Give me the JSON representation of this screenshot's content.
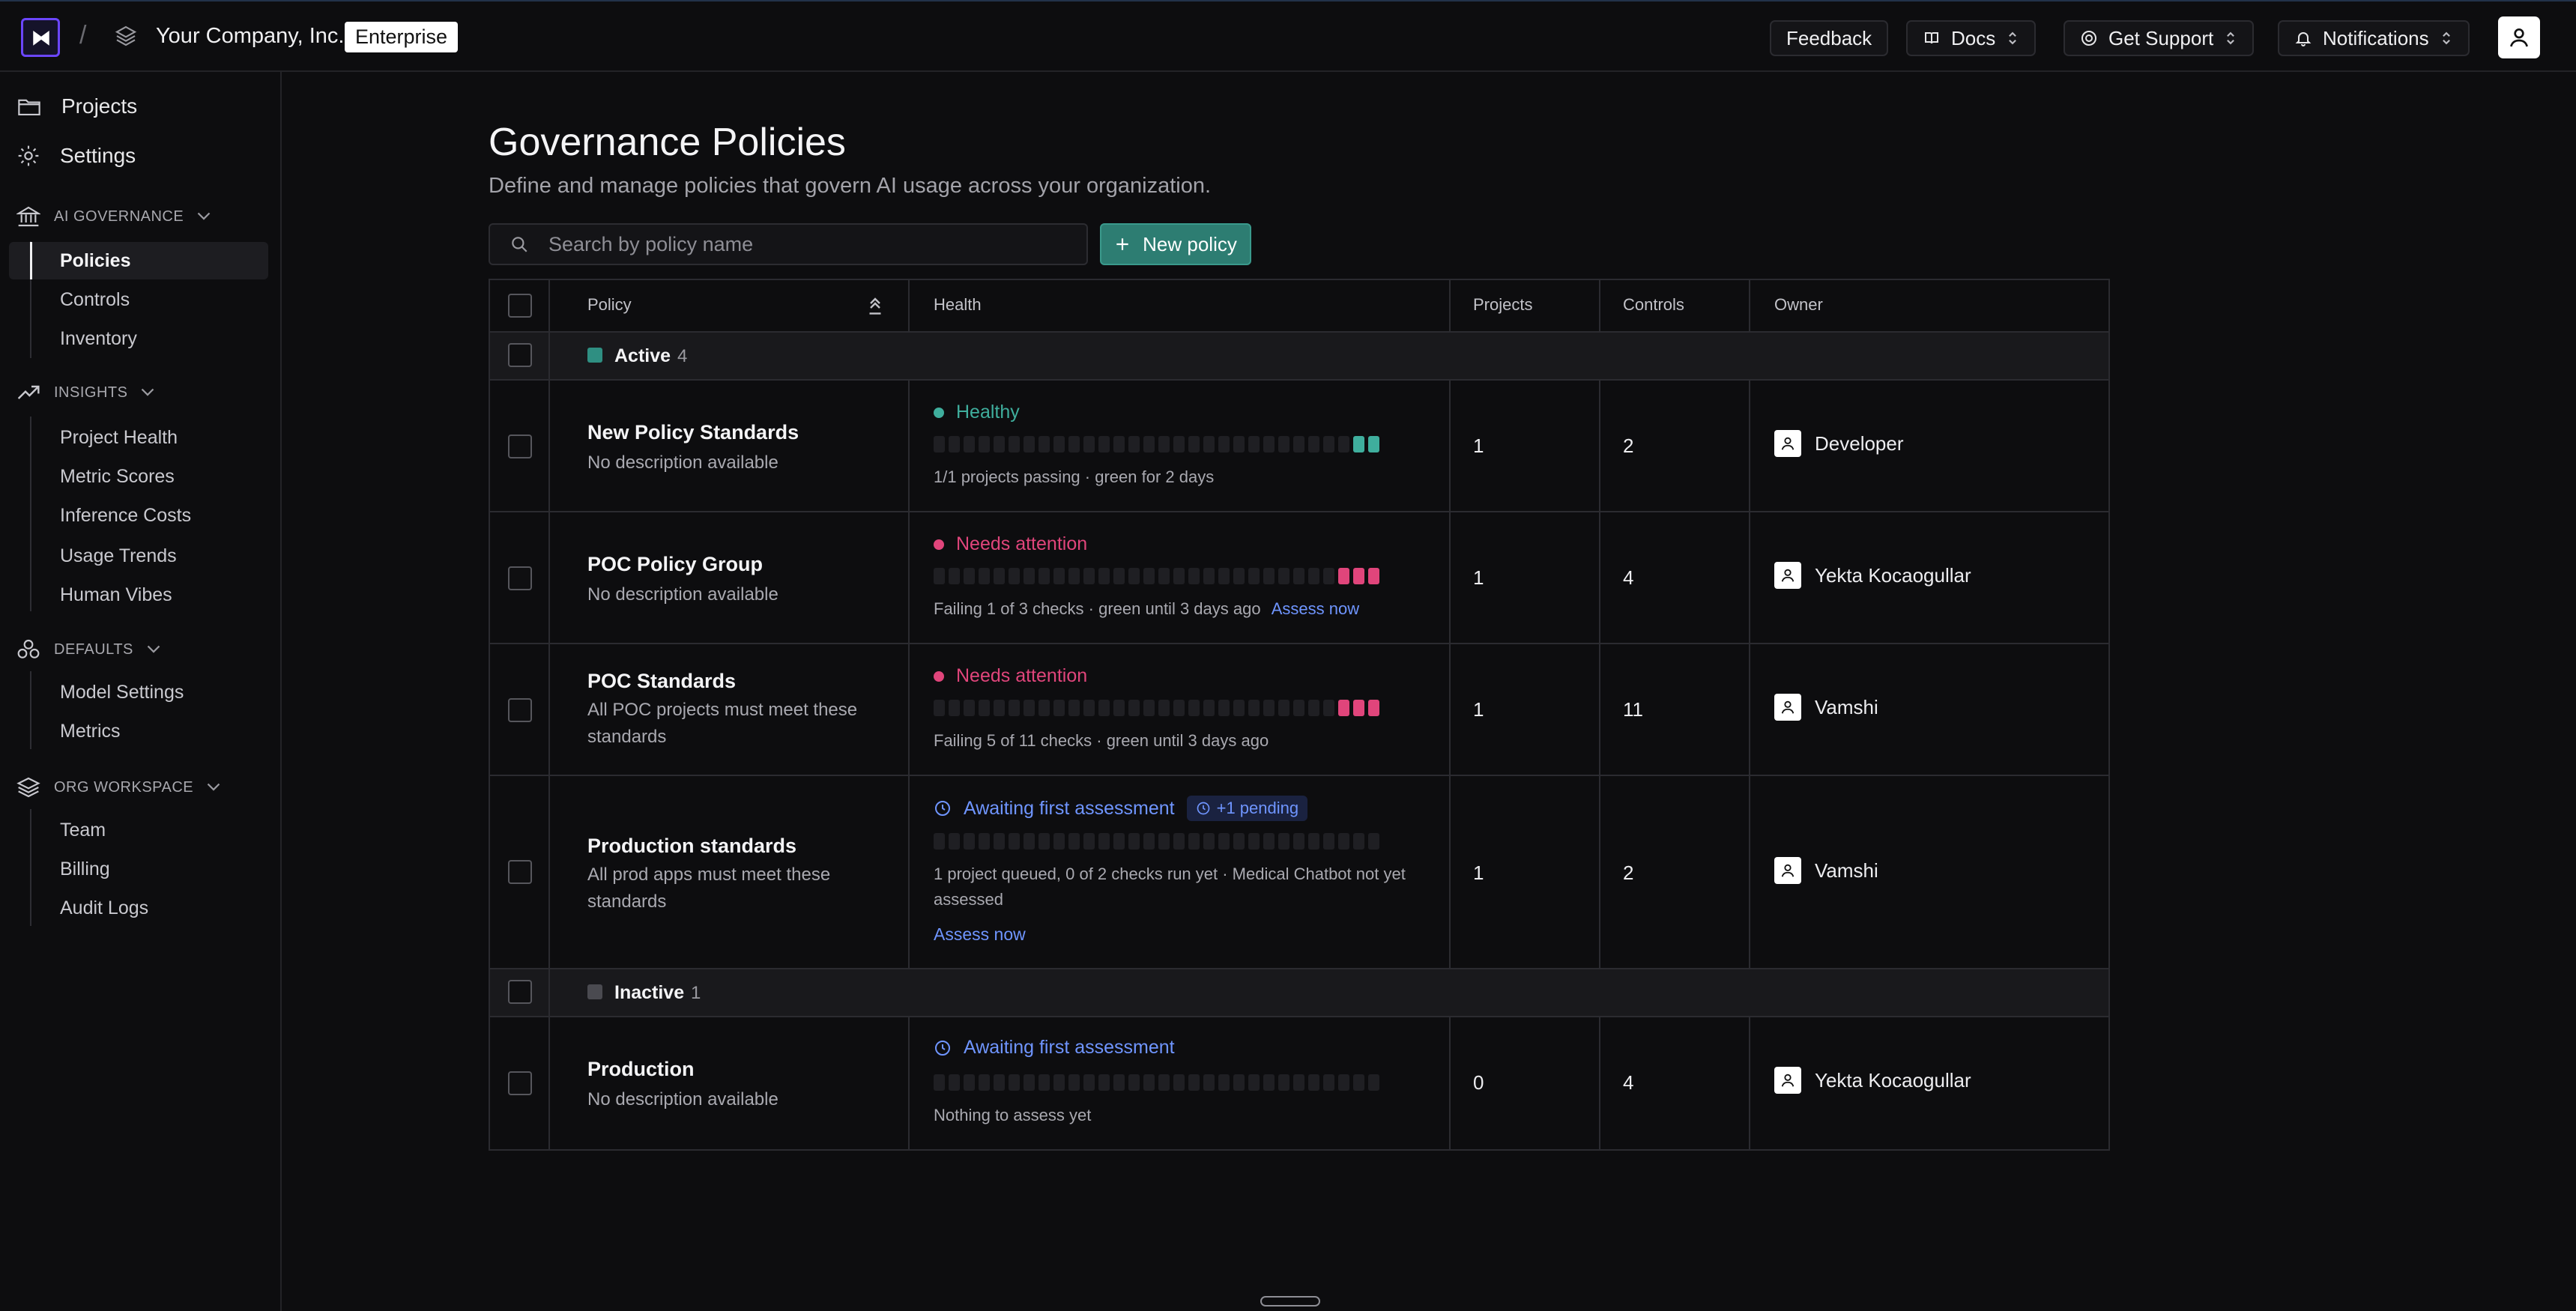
{
  "topbar": {
    "company": "Your Company, Inc.",
    "plan": "Enterprise",
    "feedback": "Feedback",
    "docs": "Docs",
    "support": "Get Support",
    "notifications": "Notifications"
  },
  "sidebar": {
    "projects": "Projects",
    "settings": "Settings",
    "ai_governance": {
      "title": "AI GOVERNANCE",
      "items": [
        "Policies",
        "Controls",
        "Inventory"
      ]
    },
    "insights": {
      "title": "INSIGHTS",
      "items": [
        "Project Health",
        "Metric Scores",
        "Inference Costs",
        "Usage Trends",
        "Human Vibes"
      ]
    },
    "defaults": {
      "title": "DEFAULTS",
      "items": [
        "Model Settings",
        "Metrics"
      ]
    },
    "org_workspace": {
      "title": "ORG WORKSPACE",
      "items": [
        "Team",
        "Billing",
        "Audit Logs"
      ]
    }
  },
  "main": {
    "title": "Governance Policies",
    "subtitle": "Define and manage policies that govern AI usage across your organization.",
    "search_placeholder": "Search by policy name",
    "new_policy": "New policy"
  },
  "table": {
    "headers": [
      "Policy",
      "Health",
      "Projects",
      "Controls",
      "Owner"
    ],
    "groups": [
      {
        "label": "Active",
        "count": "4",
        "color": "#2f8f82"
      },
      {
        "label": "Inactive",
        "count": "1",
        "color": "#4a4a50"
      }
    ],
    "rows": [
      {
        "name": "New Policy Standards",
        "description": "No description available",
        "status": "Healthy",
        "status_color": "#3fae9d",
        "note": "1/1 projects passing · green for 2 days",
        "assess": "",
        "pending": "",
        "projects": "1",
        "controls": "2",
        "owner": "Developer",
        "colored_bars": 2,
        "bar_color": "#3fae9d"
      },
      {
        "name": "POC Policy Group",
        "description": "No description available",
        "status": "Needs attention",
        "status_color": "#e0457b",
        "note": "Failing 1 of 3 checks · green until 3 days ago",
        "assess": "Assess now",
        "pending": "",
        "projects": "1",
        "controls": "4",
        "owner": "Yekta Kocaogullar",
        "colored_bars": 3,
        "bar_color": "#e0457b"
      },
      {
        "name": "POC Standards",
        "description": "All POC projects must meet these standards",
        "status": "Needs attention",
        "status_color": "#e0457b",
        "note": "Failing 5 of 11 checks · green until 3 days ago",
        "assess": "",
        "pending": "",
        "projects": "1",
        "controls": "11",
        "owner": "Vamshi",
        "colored_bars": 3,
        "bar_color": "#e0457b"
      },
      {
        "name": "Production standards",
        "description": "All prod apps must meet these standards",
        "status": "Awaiting first assessment",
        "status_color": "#6f95ff",
        "note": "1 project queued, 0 of 2 checks run yet · Medical Chatbot not yet assessed",
        "assess": "Assess now",
        "pending": "+1 pending",
        "projects": "1",
        "controls": "2",
        "owner": "Vamshi",
        "colored_bars": 0,
        "bar_color": ""
      },
      {
        "name": "Production",
        "description": "No description available",
        "status": "Awaiting first assessment",
        "status_color": "#6f95ff",
        "note": "Nothing to assess yet",
        "assess": "",
        "pending": "",
        "projects": "0",
        "controls": "4",
        "owner": "Yekta Kocaogullar",
        "colored_bars": 0,
        "bar_color": ""
      }
    ]
  },
  "colors": {
    "accent": "#2d7d72",
    "brand": "#6b46ff",
    "link": "#6f95ff"
  }
}
